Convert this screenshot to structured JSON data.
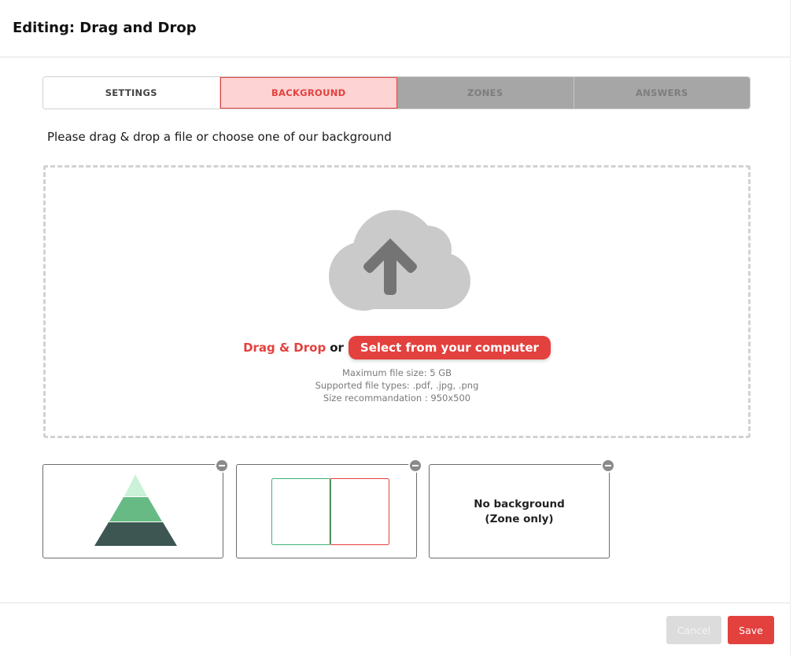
{
  "header": {
    "title": "Editing: Drag and Drop"
  },
  "tabs": [
    {
      "label": "SETTINGS",
      "state": "default"
    },
    {
      "label": "BACKGROUND",
      "state": "active"
    },
    {
      "label": "ZONES",
      "state": "disabled"
    },
    {
      "label": "ANSWERS",
      "state": "disabled"
    }
  ],
  "instruction": "Please drag & drop a file or choose one of our background",
  "dropzone": {
    "icon": "cloud-upload-icon",
    "drag_label": "Drag & Drop",
    "or_label": "or",
    "select_button": "Select from your computer",
    "info": [
      "Maximum file size: 5 GB",
      "Supported file types: .pdf, .jpg, .png",
      "Size recommandation : 950x500"
    ]
  },
  "backgrounds": [
    {
      "kind": "pyramid-image",
      "icon": "pyramid-icon"
    },
    {
      "kind": "two-columns-image",
      "icon": "two-columns-icon"
    },
    {
      "kind": "none",
      "line1": "No background",
      "line2": "(Zone only)"
    }
  ],
  "footer": {
    "cancel_label": "Cancel",
    "save_label": "Save"
  },
  "colors": {
    "accent": "#e3413e",
    "active_tab_bg": "#fdd3d4",
    "disabled_tab_bg": "#a6a6a6",
    "pyramid_top": "#c9f2d8",
    "pyramid_mid": "#67ba84",
    "pyramid_base": "#3d5652",
    "column_left_border": "#3fb37a",
    "column_right_border": "#e3413e"
  }
}
